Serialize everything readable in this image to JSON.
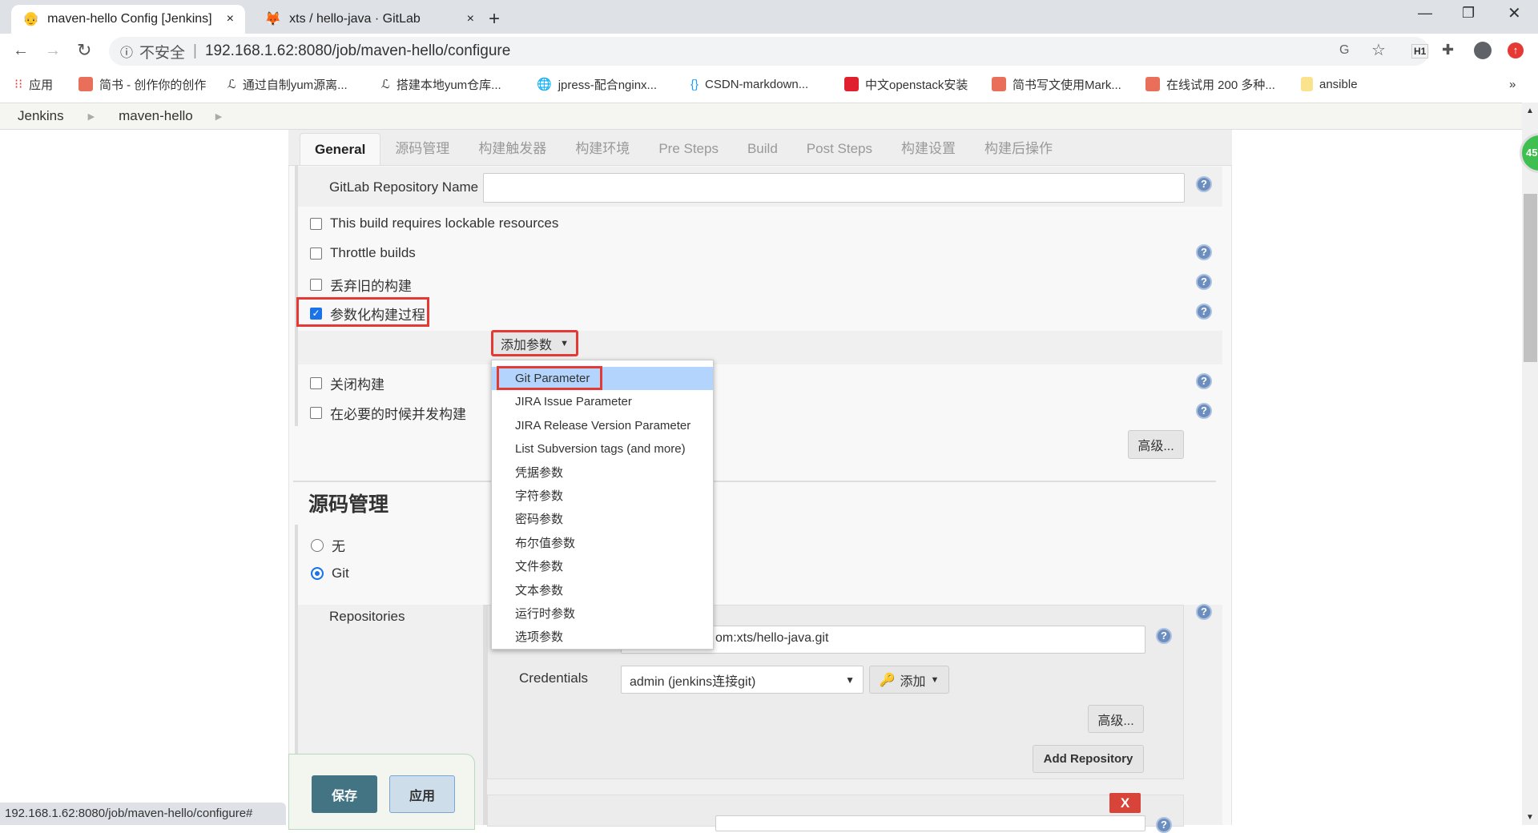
{
  "browser": {
    "tabs": [
      {
        "title": "maven-hello Config [Jenkins]",
        "active": true,
        "icon": "jenkins-icon"
      },
      {
        "title": "xts / hello-java · GitLab",
        "active": false,
        "icon": "gitlab-icon"
      }
    ],
    "new_tab": "+",
    "close": "×",
    "security_label": "不安全",
    "url": "192.168.1.62:8080/job/maven-hello/configure",
    "bookmarks": [
      "应用",
      "简书 - 创作你的创作",
      "通过自制yum源离...",
      "搭建本地yum仓库...",
      "jpress-配合nginx...",
      "CSDN-markdown...",
      "中文openstack安装",
      "简书写文使用Mark...",
      "在线试用 200 多种...",
      "ansible"
    ],
    "more": "»",
    "status_url": "192.168.1.62:8080/job/maven-hello/configure#"
  },
  "breadcrumb": [
    "Jenkins",
    "maven-hello"
  ],
  "config_tabs": [
    "General",
    "源码管理",
    "构建触发器",
    "构建环境",
    "Pre Steps",
    "Build",
    "Post Steps",
    "构建设置",
    "构建后操作"
  ],
  "general": {
    "gitlab_repo_label": "GitLab Repository Name",
    "gitlab_repo_value": "",
    "options": [
      {
        "label": "This build requires lockable resources",
        "checked": false
      },
      {
        "label": "Throttle builds",
        "checked": false
      },
      {
        "label": "丢弃旧的构建",
        "checked": false
      },
      {
        "label": "参数化构建过程",
        "checked": true
      },
      {
        "label": "关闭构建",
        "checked": false
      },
      {
        "label": "在必要的时候并发构建",
        "checked": false
      }
    ],
    "add_param_button": "添加参数",
    "param_menu": [
      "Git Parameter",
      "JIRA Issue Parameter",
      "JIRA Release Version Parameter",
      "List Subversion tags (and more)",
      "凭据参数",
      "字符参数",
      "密码参数",
      "布尔值参数",
      "文件参数",
      "文本参数",
      "运行时参数",
      "选项参数"
    ],
    "advanced_button": "高级..."
  },
  "scm": {
    "heading": "源码管理",
    "options": [
      {
        "label": "无",
        "selected": false
      },
      {
        "label": "Git",
        "selected": true
      }
    ],
    "repositories_label": "Repositories",
    "repo_url_visible": "om:xts/hello-java.git",
    "credentials_label": "Credentials",
    "credentials_value": "admin (jenkins连接git)",
    "add_button": "添加",
    "advanced_button": "高级...",
    "add_repository_button": "Add Repository",
    "delete_button": "X"
  },
  "footer": {
    "save": "保存",
    "apply": "应用"
  },
  "badge": "45",
  "colors": {
    "save": "#437483",
    "apply": "#cddde9",
    "menu_selected": "#b3d4fc",
    "highlight": "#e53935"
  }
}
